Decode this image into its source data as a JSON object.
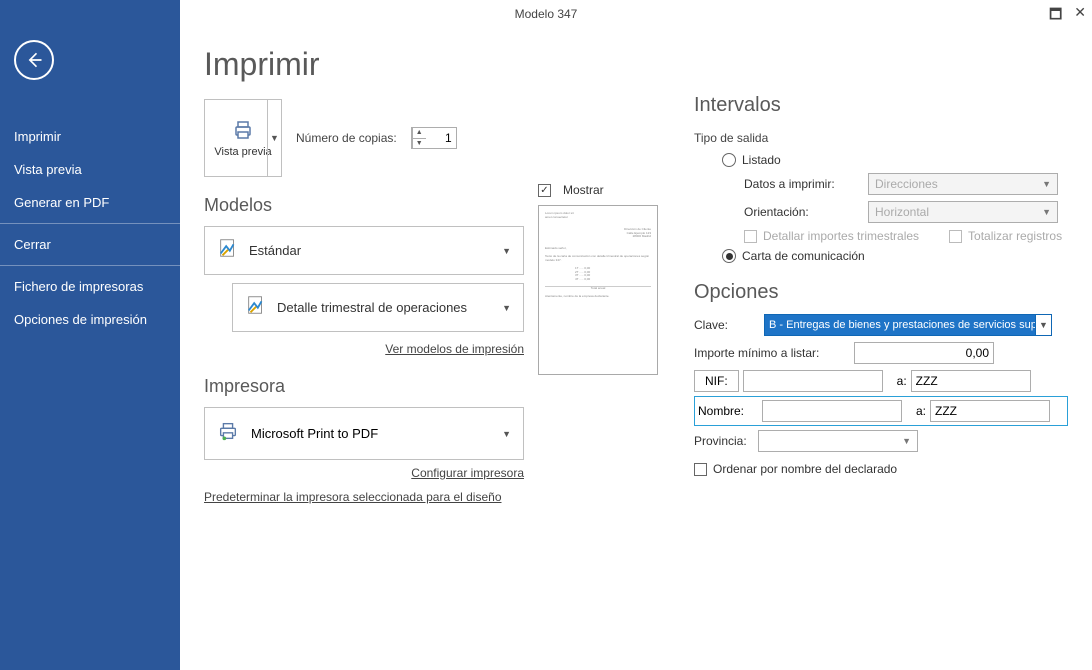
{
  "window": {
    "title": "Modelo 347"
  },
  "sidebar": {
    "items": [
      "Imprimir",
      "Vista previa",
      "Generar en PDF",
      "Cerrar",
      "Fichero de impresoras",
      "Opciones de impresión"
    ]
  },
  "page": {
    "title": "Imprimir",
    "preview_label": "Vista previa",
    "copies_label": "Número de copias:",
    "copies_value": "1",
    "section_modelos": "Modelos",
    "mostrar": "Mostrar",
    "model_estandar": "Estándar",
    "model_detalle": "Detalle trimestral de operaciones",
    "link_ver_modelos": "Ver modelos de impresión",
    "section_impresora": "Impresora",
    "printer_name": "Microsoft Print to PDF",
    "link_configurar": "Configurar impresora",
    "link_predeterminar": "Predeterminar la impresora seleccionada para el diseño"
  },
  "intervalos": {
    "title": "Intervalos",
    "tipo_salida": "Tipo de salida",
    "listado": "Listado",
    "datos_a_imprimir": "Datos a imprimir:",
    "datos_value": "Direcciones",
    "orientacion": "Orientación:",
    "orientacion_value": "Horizontal",
    "detallar": "Detallar importes trimestrales",
    "totalizar": "Totalizar registros",
    "carta": "Carta de comunicación"
  },
  "opciones": {
    "title": "Opciones",
    "clave": "Clave:",
    "clave_value": "B - Entregas de bienes y prestaciones de servicios superior",
    "importe_min": "Importe mínimo a listar:",
    "importe_value": "0,00",
    "nif": "NIF:",
    "a": "a:",
    "nif_to": "ZZZ",
    "nombre": "Nombre:",
    "nombre_to": "ZZZ",
    "provincia": "Provincia:",
    "ordenar": "Ordenar por nombre del declarado"
  }
}
